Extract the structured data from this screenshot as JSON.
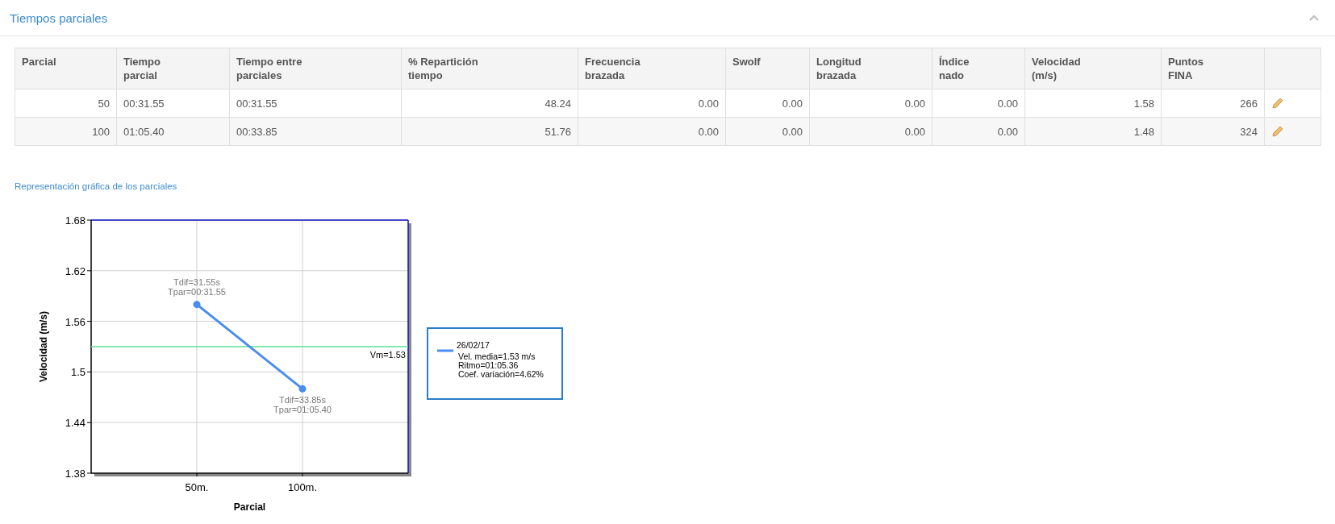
{
  "panel": {
    "title": "Tiempos parciales"
  },
  "table": {
    "columns": [
      {
        "label": "Parcial",
        "kind": "number"
      },
      {
        "label": "Tiempo\nparcial",
        "kind": "text"
      },
      {
        "label": "Tiempo entre\nparciales",
        "kind": "text"
      },
      {
        "label": "% Repartición\ntiempo",
        "kind": "number"
      },
      {
        "label": "Frecuencia\nbrazada",
        "kind": "number"
      },
      {
        "label": "Swolf",
        "kind": "number"
      },
      {
        "label": "Longitud\nbrazada",
        "kind": "number"
      },
      {
        "label": "Índice\nnado",
        "kind": "number"
      },
      {
        "label": "Velocidad\n(m/s)",
        "kind": "number"
      },
      {
        "label": "Puntos\nFINA",
        "kind": "number"
      }
    ],
    "rows": [
      [
        "50",
        "00:31.55",
        "00:31.55",
        "48.24",
        "0.00",
        "0.00",
        "0.00",
        "0.00",
        "1.58",
        "266"
      ],
      [
        "100",
        "01:05.40",
        "00:33.85",
        "51.76",
        "0.00",
        "0.00",
        "0.00",
        "0.00",
        "1.48",
        "324"
      ]
    ]
  },
  "chart_section": {
    "title": "Representación gráfica de los parciales",
    "chart_data": {
      "type": "line",
      "xlabel": "Parcial",
      "ylabel": "Velocidad (m/s)",
      "categories": [
        "50m.",
        "100m."
      ],
      "series": [
        {
          "name": "26/02/17",
          "color": "#4a8cf0",
          "marker": "circle",
          "values": [
            1.58,
            1.48
          ]
        }
      ],
      "grid": true,
      "ylim": [
        1.38,
        1.68
      ],
      "yticks": [
        {
          "value": 1.38,
          "label": "1.38"
        },
        {
          "value": 1.44,
          "label": "1.44"
        },
        {
          "value": 1.5,
          "label": "1.5"
        },
        {
          "value": 1.56,
          "label": "1.56"
        },
        {
          "value": 1.62,
          "label": "1.62"
        },
        {
          "value": 1.68,
          "label": "1.68"
        }
      ],
      "ref_lines": [
        {
          "axis": "y",
          "value": 1.53,
          "label": "Vm=1.53",
          "color": "#57e39a"
        }
      ],
      "annotations": [
        {
          "text": "Tdif=31.55s",
          "x": "50m.",
          "y": 1.58
        },
        {
          "text": "Tpar=00:31.55",
          "x": "50m.",
          "y": 1.58
        },
        {
          "text": "Tdif=33.85s",
          "x": "100m.",
          "y": 1.48
        },
        {
          "text": "Tpar=01:05.40",
          "x": "100m.",
          "y": 1.48
        }
      ]
    },
    "legend": {
      "lines": [
        "Vel. media=1.53 m/s",
        "Ritmo=01:05.36",
        "Coef. variación=4.62%"
      ]
    }
  }
}
